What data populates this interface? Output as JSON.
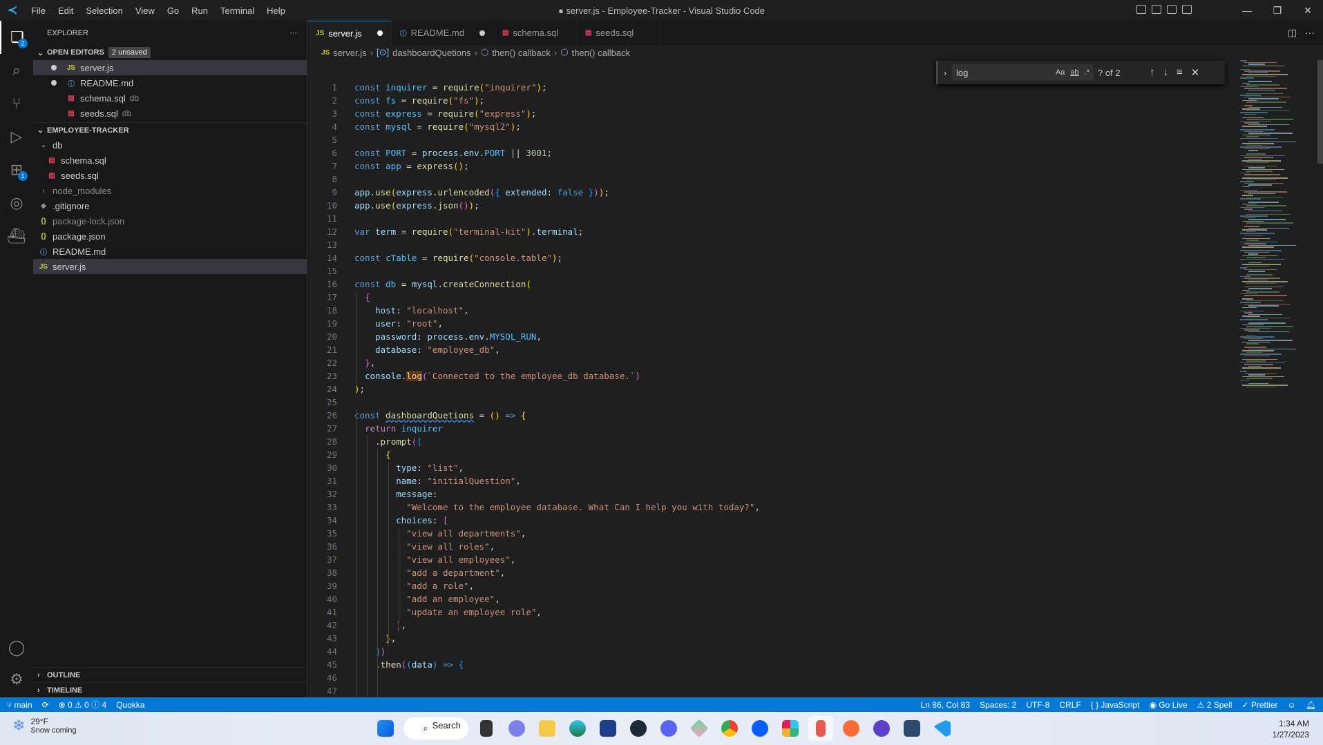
{
  "titlebar": {
    "title": "● server.js - Employee-Tracker - Visual Studio Code",
    "menu": [
      "File",
      "Edit",
      "Selection",
      "View",
      "Go",
      "Run",
      "Terminal",
      "Help"
    ]
  },
  "activity": {
    "explorer_badge": "2",
    "extensions_badge": "1"
  },
  "sidebar": {
    "title": "EXPLORER",
    "more": "···",
    "open_editors": {
      "label": "OPEN EDITORS",
      "badge": "2 unsaved",
      "items": [
        {
          "icon": "JS",
          "name": "server.js",
          "desc": "",
          "dirty": true
        },
        {
          "icon": "ⓘ",
          "name": "README.md",
          "desc": "",
          "dirty": true
        },
        {
          "icon": "▤",
          "name": "schema.sql",
          "desc": "db",
          "dirty": false
        },
        {
          "icon": "▤",
          "name": "seeds.sql",
          "desc": "db",
          "dirty": false
        }
      ]
    },
    "project": {
      "label": "EMPLOYEE-TRACKER",
      "items": [
        {
          "icon": "⌄",
          "name": "db",
          "depth": 0
        },
        {
          "icon": "▤",
          "name": "schema.sql",
          "depth": 1
        },
        {
          "icon": "▤",
          "name": "seeds.sql",
          "depth": 1
        },
        {
          "icon": "›",
          "name": "node_modules",
          "depth": 0
        },
        {
          "icon": "◆",
          "name": ".gitignore",
          "depth": 0
        },
        {
          "icon": "{}",
          "name": "package-lock.json",
          "depth": 0
        },
        {
          "icon": "{}",
          "name": "package.json",
          "depth": 0
        },
        {
          "icon": "ⓘ",
          "name": "README.md",
          "depth": 0
        },
        {
          "icon": "JS",
          "name": "server.js",
          "depth": 0
        }
      ]
    },
    "outline": "OUTLINE",
    "timeline": "TIMELINE"
  },
  "tabs": [
    {
      "icon": "JS",
      "label": "server.js",
      "active": true,
      "dirty": true
    },
    {
      "icon": "ⓘ",
      "label": "README.md",
      "active": false,
      "dirty": true
    },
    {
      "icon": "▤",
      "label": "schema.sql",
      "active": false,
      "dirty": false
    },
    {
      "icon": "▤",
      "label": "seeds.sql",
      "active": false,
      "dirty": false
    }
  ],
  "breadcrumb": [
    "server.js",
    "dashboardQuetions",
    "then() callback",
    "then() callback"
  ],
  "find": {
    "query": "log",
    "count": "? of 2",
    "opt_case": "Aa",
    "opt_word": "ab",
    "opt_regex": ".*"
  },
  "code": [
    [
      [
        "k",
        "const "
      ],
      [
        "c",
        "inquirer"
      ],
      [
        "p",
        " = "
      ],
      [
        "f",
        "require"
      ],
      [
        "b1",
        "("
      ],
      [
        "s",
        "\"inquirer\""
      ],
      [
        "b1",
        ")"
      ],
      [
        "p",
        ";"
      ]
    ],
    [
      [
        "k",
        "const "
      ],
      [
        "c",
        "fs"
      ],
      [
        "p",
        " = "
      ],
      [
        "f",
        "require"
      ],
      [
        "b1",
        "("
      ],
      [
        "s",
        "\"fs\""
      ],
      [
        "b1",
        ")"
      ],
      [
        "p",
        ";"
      ]
    ],
    [
      [
        "k",
        "const "
      ],
      [
        "c",
        "express"
      ],
      [
        "p",
        " = "
      ],
      [
        "f",
        "require"
      ],
      [
        "b1",
        "("
      ],
      [
        "s",
        "\"express\""
      ],
      [
        "b1",
        ")"
      ],
      [
        "p",
        ";"
      ]
    ],
    [
      [
        "k",
        "const "
      ],
      [
        "c",
        "mysql"
      ],
      [
        "p",
        " = "
      ],
      [
        "f",
        "require"
      ],
      [
        "b1",
        "("
      ],
      [
        "s",
        "\"mysql2\""
      ],
      [
        "b1",
        ")"
      ],
      [
        "p",
        ";"
      ]
    ],
    [],
    [
      [
        "k",
        "const "
      ],
      [
        "c",
        "PORT"
      ],
      [
        "p",
        " = "
      ],
      [
        "v",
        "process"
      ],
      [
        "p",
        "."
      ],
      [
        "v",
        "env"
      ],
      [
        "p",
        "."
      ],
      [
        "c",
        "PORT"
      ],
      [
        "p",
        " || "
      ],
      [
        "n",
        "3001"
      ],
      [
        "p",
        ";"
      ]
    ],
    [
      [
        "k",
        "const "
      ],
      [
        "c",
        "app"
      ],
      [
        "p",
        " = "
      ],
      [
        "f",
        "express"
      ],
      [
        "b1",
        "()"
      ],
      [
        "p",
        ";"
      ]
    ],
    [],
    [
      [
        "v",
        "app"
      ],
      [
        "p",
        "."
      ],
      [
        "f",
        "use"
      ],
      [
        "b1",
        "("
      ],
      [
        "v",
        "express"
      ],
      [
        "p",
        "."
      ],
      [
        "f",
        "urlencoded"
      ],
      [
        "b2",
        "("
      ],
      [
        "b3",
        "{ "
      ],
      [
        "v",
        "extended"
      ],
      [
        "p",
        ": "
      ],
      [
        "k",
        "false"
      ],
      [
        "b3",
        " }"
      ],
      [
        "b2",
        ")"
      ],
      [
        "b1",
        ")"
      ],
      [
        "p",
        ";"
      ]
    ],
    [
      [
        "v",
        "app"
      ],
      [
        "p",
        "."
      ],
      [
        "f",
        "use"
      ],
      [
        "b1",
        "("
      ],
      [
        "v",
        "express"
      ],
      [
        "p",
        "."
      ],
      [
        "f",
        "json"
      ],
      [
        "b2",
        "()"
      ],
      [
        "b1",
        ")"
      ],
      [
        "p",
        ";"
      ]
    ],
    [],
    [
      [
        "k",
        "var "
      ],
      [
        "v",
        "term"
      ],
      [
        "p",
        " = "
      ],
      [
        "f",
        "require"
      ],
      [
        "b1",
        "("
      ],
      [
        "s",
        "\"terminal-kit\""
      ],
      [
        "b1",
        ")"
      ],
      [
        "p",
        "."
      ],
      [
        "v",
        "terminal"
      ],
      [
        "p",
        ";"
      ]
    ],
    [],
    [
      [
        "k",
        "const "
      ],
      [
        "c",
        "cTable"
      ],
      [
        "p",
        " = "
      ],
      [
        "f",
        "require"
      ],
      [
        "b1",
        "("
      ],
      [
        "s",
        "\"console.table\""
      ],
      [
        "b1",
        ")"
      ],
      [
        "p",
        ";"
      ]
    ],
    [],
    [
      [
        "k",
        "const "
      ],
      [
        "c",
        "db"
      ],
      [
        "p",
        " = "
      ],
      [
        "v",
        "mysql"
      ],
      [
        "p",
        "."
      ],
      [
        "f",
        "createConnection"
      ],
      [
        "b1",
        "("
      ]
    ],
    [
      [
        "p",
        "  "
      ],
      [
        "b2",
        "{"
      ]
    ],
    [
      [
        "p",
        "    "
      ],
      [
        "v",
        "host"
      ],
      [
        "p",
        ": "
      ],
      [
        "s",
        "\"localhost\""
      ],
      [
        "p",
        ","
      ]
    ],
    [
      [
        "p",
        "    "
      ],
      [
        "v",
        "user"
      ],
      [
        "p",
        ": "
      ],
      [
        "s",
        "\"root\""
      ],
      [
        "p",
        ","
      ]
    ],
    [
      [
        "p",
        "    "
      ],
      [
        "v",
        "password"
      ],
      [
        "p",
        ": "
      ],
      [
        "v",
        "process"
      ],
      [
        "p",
        "."
      ],
      [
        "v",
        "env"
      ],
      [
        "p",
        "."
      ],
      [
        "c",
        "MYSQL_RUN"
      ],
      [
        "p",
        ","
      ]
    ],
    [
      [
        "p",
        "    "
      ],
      [
        "v",
        "database"
      ],
      [
        "p",
        ": "
      ],
      [
        "s",
        "\"employee_db\""
      ],
      [
        "p",
        ","
      ]
    ],
    [
      [
        "p",
        "  "
      ],
      [
        "b2",
        "}"
      ],
      [
        "p",
        ","
      ]
    ],
    [
      [
        "p",
        "  "
      ],
      [
        "v",
        "console"
      ],
      [
        "p",
        "."
      ],
      [
        "hl",
        "log"
      ],
      [
        "b2",
        "("
      ],
      [
        "s",
        "`Connected to the employee_db database.`"
      ],
      [
        "b2",
        ")"
      ]
    ],
    [
      [
        "b1",
        ")"
      ],
      [
        "p",
        ";"
      ]
    ],
    [],
    [
      [
        "k",
        "const "
      ],
      [
        "sq",
        "dashboardQuetions"
      ],
      [
        "p",
        " = "
      ],
      [
        "b1",
        "()"
      ],
      [
        "k",
        " => "
      ],
      [
        "b1",
        "{"
      ]
    ],
    [
      [
        "p",
        "  "
      ],
      [
        "kc",
        "return "
      ],
      [
        "c",
        "inquirer"
      ]
    ],
    [
      [
        "p",
        "    ."
      ],
      [
        "f",
        "prompt"
      ],
      [
        "b2",
        "("
      ],
      [
        "b3",
        "["
      ]
    ],
    [
      [
        "p",
        "      "
      ],
      [
        "b1",
        "{"
      ]
    ],
    [
      [
        "p",
        "        "
      ],
      [
        "v",
        "type"
      ],
      [
        "p",
        ": "
      ],
      [
        "s",
        "\"list\""
      ],
      [
        "p",
        ","
      ]
    ],
    [
      [
        "p",
        "        "
      ],
      [
        "v",
        "name"
      ],
      [
        "p",
        ": "
      ],
      [
        "s",
        "\"initialQuestion\""
      ],
      [
        "p",
        ","
      ]
    ],
    [
      [
        "p",
        "        "
      ],
      [
        "v",
        "message"
      ],
      [
        "p",
        ":"
      ]
    ],
    [
      [
        "p",
        "          "
      ],
      [
        "s",
        "\"Welcome to the employee database. What Can I help you with today?\""
      ],
      [
        "p",
        ","
      ]
    ],
    [
      [
        "p",
        "        "
      ],
      [
        "v",
        "choices"
      ],
      [
        "p",
        ": "
      ],
      [
        "b2",
        "["
      ]
    ],
    [
      [
        "p",
        "          "
      ],
      [
        "s",
        "\"view all departments\""
      ],
      [
        "p",
        ","
      ]
    ],
    [
      [
        "p",
        "          "
      ],
      [
        "s",
        "\"view all roles\""
      ],
      [
        "p",
        ","
      ]
    ],
    [
      [
        "p",
        "          "
      ],
      [
        "s",
        "\"view all employees\""
      ],
      [
        "p",
        ","
      ]
    ],
    [
      [
        "p",
        "          "
      ],
      [
        "s",
        "\"add a department\""
      ],
      [
        "p",
        ","
      ]
    ],
    [
      [
        "p",
        "          "
      ],
      [
        "s",
        "\"add a role\""
      ],
      [
        "p",
        ","
      ]
    ],
    [
      [
        "p",
        "          "
      ],
      [
        "s",
        "\"add an employee\""
      ],
      [
        "p",
        ","
      ]
    ],
    [
      [
        "p",
        "          "
      ],
      [
        "s",
        "\"update an employee role\""
      ],
      [
        "p",
        ","
      ]
    ],
    [
      [
        "p",
        "        "
      ],
      [
        "b2",
        "]"
      ],
      [
        "p",
        ","
      ]
    ],
    [
      [
        "p",
        "      "
      ],
      [
        "b1",
        "}"
      ],
      [
        "p",
        ","
      ]
    ],
    [
      [
        "p",
        "    "
      ],
      [
        "b3",
        "]"
      ],
      [
        "b2",
        ")"
      ]
    ],
    [
      [
        "p",
        "    ."
      ],
      [
        "f",
        "then"
      ],
      [
        "b2",
        "("
      ],
      [
        "b3",
        "("
      ],
      [
        "v",
        "data"
      ],
      [
        "b3",
        ")"
      ],
      [
        "k",
        " => "
      ],
      [
        "b3",
        "{"
      ]
    ],
    [],
    []
  ],
  "status": {
    "branch": "main",
    "sync": "⟳",
    "errors": "0",
    "warnings": "0",
    "info": "4",
    "quokka": "Quokka",
    "position": "Ln 86, Col 83",
    "spaces": "Spaces: 2",
    "encoding": "UTF-8",
    "eol": "CRLF",
    "language": "JavaScript",
    "golive": "Go Live",
    "spell": "2 Spell",
    "prettier": "Prettier"
  },
  "taskbar": {
    "temp": "29°F",
    "weather": "Snow coming",
    "search": "Search",
    "time": "1:34 AM",
    "date": "1/27/2023"
  },
  "colors": {
    "accent": "#0078d4",
    "statusbar": "#0078d4"
  }
}
